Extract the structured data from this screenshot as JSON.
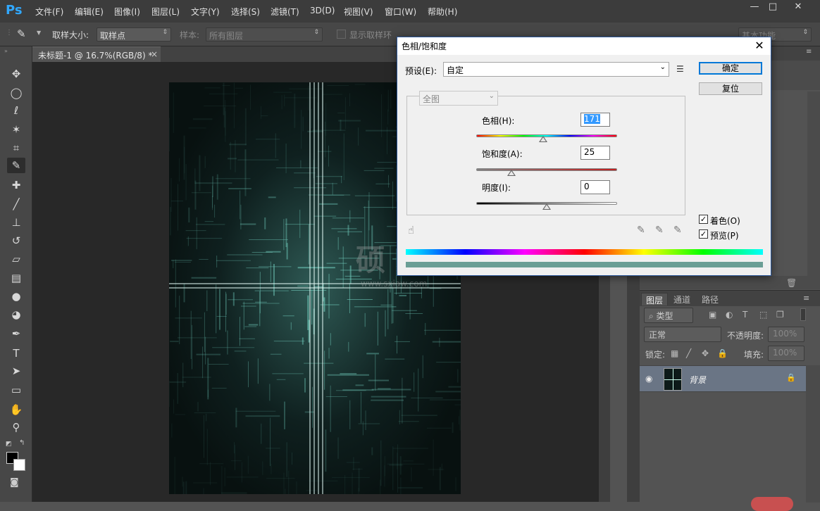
{
  "app": {
    "logo": "Ps"
  },
  "menu": [
    "文件(F)",
    "编辑(E)",
    "图像(I)",
    "图层(L)",
    "文字(Y)",
    "选择(S)",
    "滤镜(T)",
    "3D(D)",
    "视图(V)",
    "窗口(W)",
    "帮助(H)"
  ],
  "window_controls": {
    "minimize": "—",
    "maximize": "□",
    "close": "✕"
  },
  "options_bar": {
    "sample_size_label": "取样大小:",
    "sample_size_value": "取样点",
    "sample_label": "样本:",
    "sample_value": "所有图层",
    "show_ring_label": "显示取样环",
    "workspace_value": "基本功能"
  },
  "document_tab": {
    "title": "未标题-1 @ 16.7%(RGB/8) *",
    "close": "×"
  },
  "tools": [
    {
      "icon": "move-icon",
      "glyph": "✥"
    },
    {
      "icon": "ellipse-marquee-icon",
      "glyph": "◯"
    },
    {
      "icon": "lasso-icon",
      "glyph": "ℓ"
    },
    {
      "icon": "magic-wand-icon",
      "glyph": "✶"
    },
    {
      "icon": "crop-icon",
      "glyph": "⌗"
    },
    {
      "icon": "eyedropper-icon",
      "glyph": "✎"
    },
    {
      "icon": "healing-brush-icon",
      "glyph": "✚"
    },
    {
      "icon": "brush-icon",
      "glyph": "╱"
    },
    {
      "icon": "stamp-icon",
      "glyph": "⊥"
    },
    {
      "icon": "history-brush-icon",
      "glyph": "↺"
    },
    {
      "icon": "eraser-icon",
      "glyph": "▱"
    },
    {
      "icon": "gradient-icon",
      "glyph": "▤"
    },
    {
      "icon": "blur-icon",
      "glyph": "●"
    },
    {
      "icon": "dodge-icon",
      "glyph": "◕"
    },
    {
      "icon": "pen-icon",
      "glyph": "✒"
    },
    {
      "icon": "type-icon",
      "glyph": "T"
    },
    {
      "icon": "path-select-icon",
      "glyph": "➤"
    },
    {
      "icon": "rectangle-icon",
      "glyph": "▭"
    },
    {
      "icon": "hand-icon",
      "glyph": "✋"
    },
    {
      "icon": "zoom-icon",
      "glyph": "⚲"
    }
  ],
  "dialog": {
    "title": "色相/饱和度",
    "close": "✕",
    "preset_label": "预设(E):",
    "preset_value": "自定",
    "range_value": "全图",
    "ok": "确定",
    "reset": "复位",
    "hue_label": "色相(H):",
    "hue_value": "171",
    "saturation_label": "饱和度(A):",
    "saturation_value": "25",
    "lightness_label": "明度(I):",
    "lightness_value": "0",
    "colorize_label": "着色(O)",
    "colorize_checked": true,
    "preview_label": "预览(P)",
    "preview_checked": true,
    "sliders": {
      "hue_position": 0.475,
      "saturation_position": 0.25,
      "lightness_position": 0.5
    },
    "result_bar_color": "#6a9e95"
  },
  "layers_panel": {
    "tabs": [
      "图层",
      "通道",
      "路径"
    ],
    "filter_value": "类型",
    "blend_mode": "正常",
    "opacity_label": "不透明度:",
    "opacity_value": "100%",
    "lock_label": "锁定:",
    "fill_label": "填充:",
    "fill_value": "100%",
    "layer_name": "背景"
  },
  "watermark": {
    "big": "硕 夏 网",
    "small": "www.sxiaw.com"
  }
}
